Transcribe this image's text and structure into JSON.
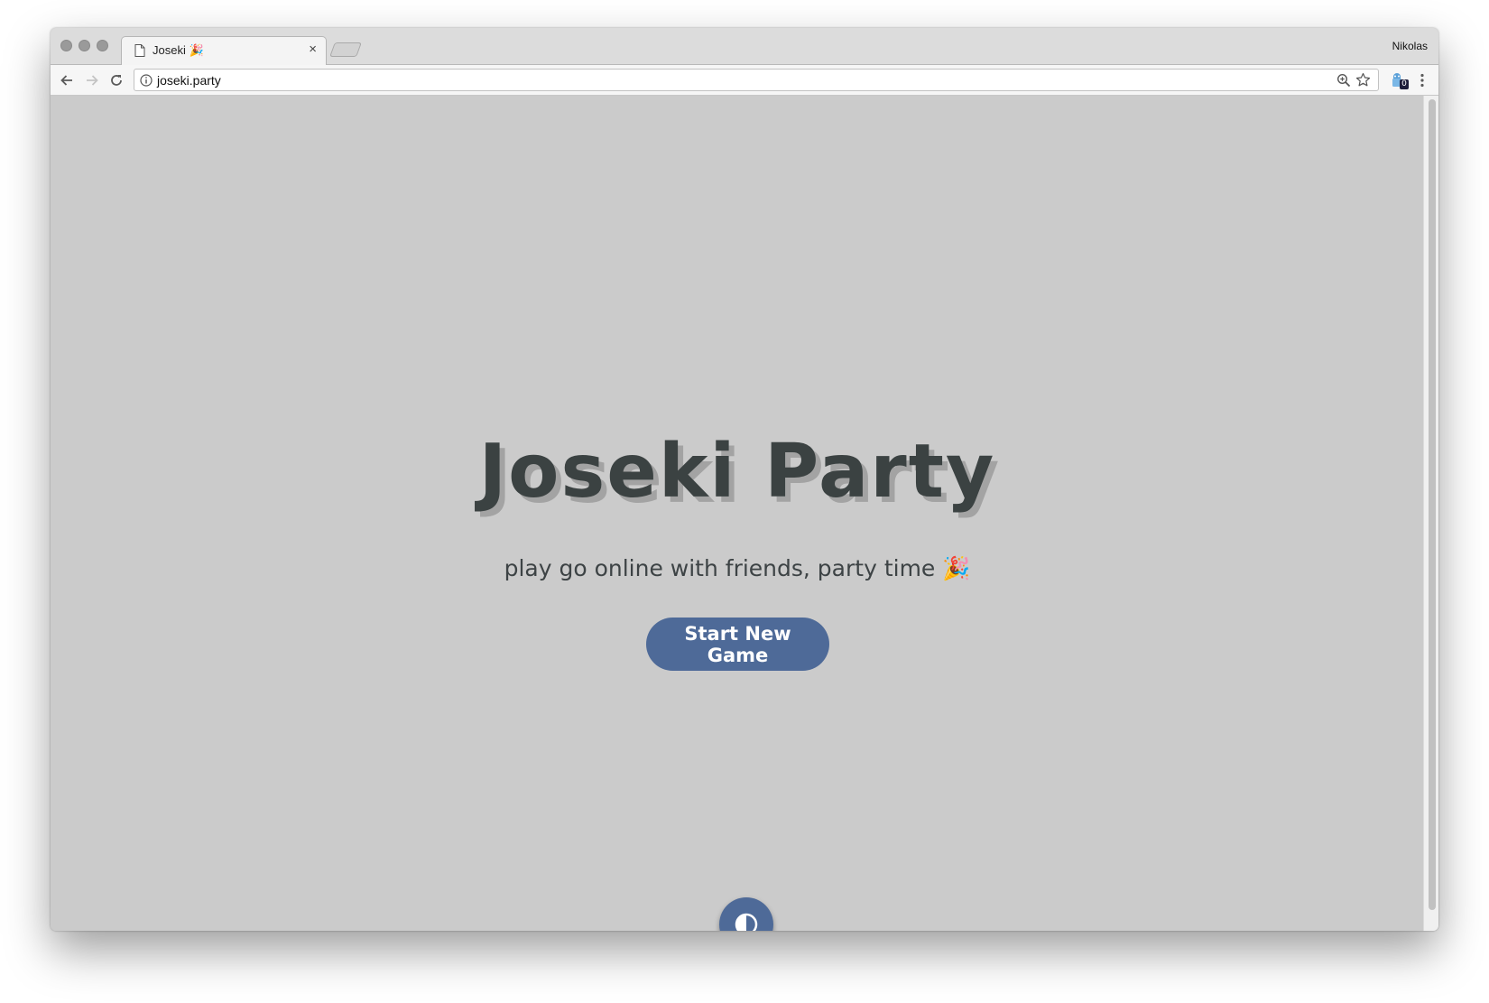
{
  "browser": {
    "tab": {
      "title": "Joseki 🎉",
      "close_glyph": "×"
    },
    "profile_name": "Nikolas",
    "url": "joseki.party",
    "extension_badge": "0"
  },
  "page": {
    "title": "Joseki Party",
    "subtitle": "play go online with friends, party time 🎉",
    "start_button_label": "Start New Game",
    "theme_toggle_icon": "contrast-icon"
  },
  "colors": {
    "page_background": "#cbcbcb",
    "accent": "#4e6a98",
    "title_text": "#3b4242",
    "title_shadow": "#a3a3a3"
  }
}
